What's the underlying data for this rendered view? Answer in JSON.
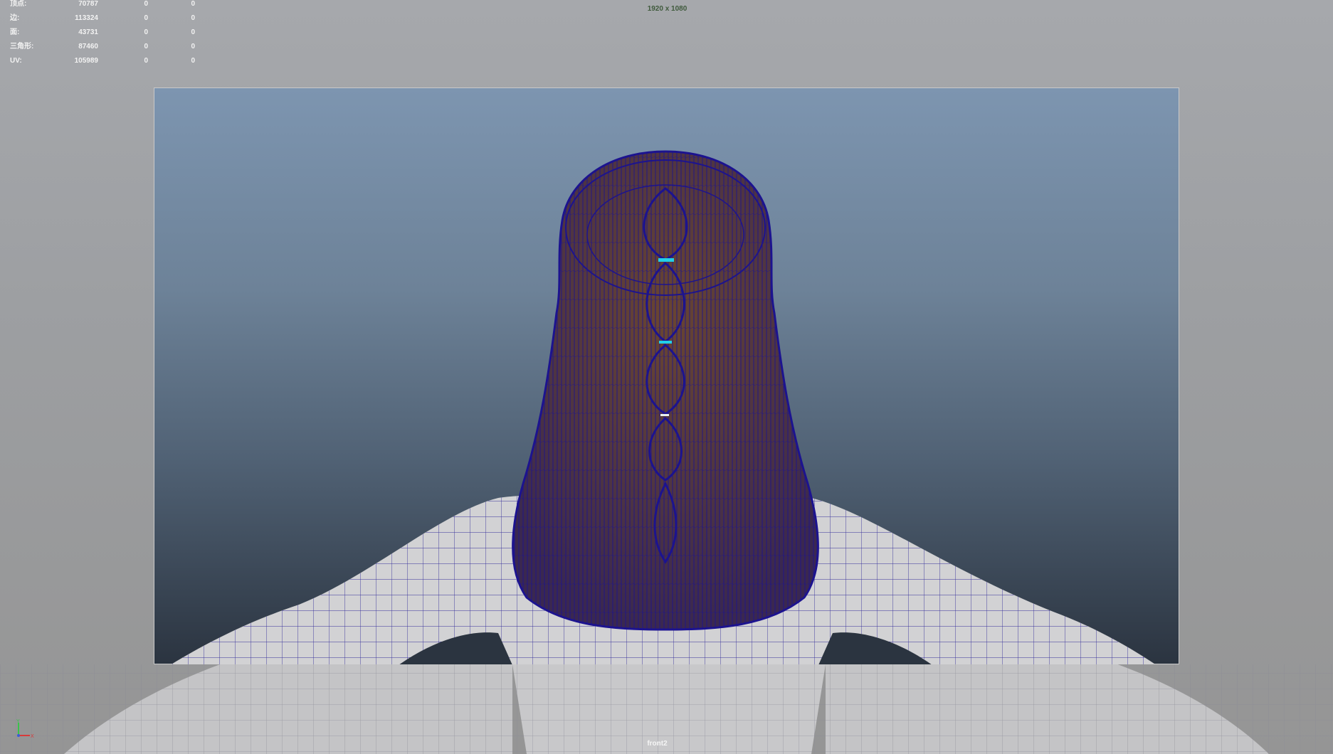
{
  "hud": {
    "rows": [
      {
        "label": "顶点:",
        "v1": "70787",
        "v2": "0",
        "v3": "0"
      },
      {
        "label": "边:",
        "v1": "113324",
        "v2": "0",
        "v3": "0"
      },
      {
        "label": "面:",
        "v1": "43731",
        "v2": "0",
        "v3": "0"
      },
      {
        "label": "三角形:",
        "v1": "87460",
        "v2": "0",
        "v3": "0"
      },
      {
        "label": "UV:",
        "v1": "105989",
        "v2": "0",
        "v3": "0"
      }
    ]
  },
  "resolution_label": "1920 x 1080",
  "camera_name": "front2",
  "axes": {
    "y": "Y",
    "x": "X"
  },
  "colors": {
    "wireframe": "#1c138f",
    "hair_fill": "#5a3a2a",
    "body_fill": "#d2d2d4",
    "gate_top": "#7d95b0",
    "gate_bottom": "#2b3440",
    "selection_highlight": "#22d0e8"
  }
}
